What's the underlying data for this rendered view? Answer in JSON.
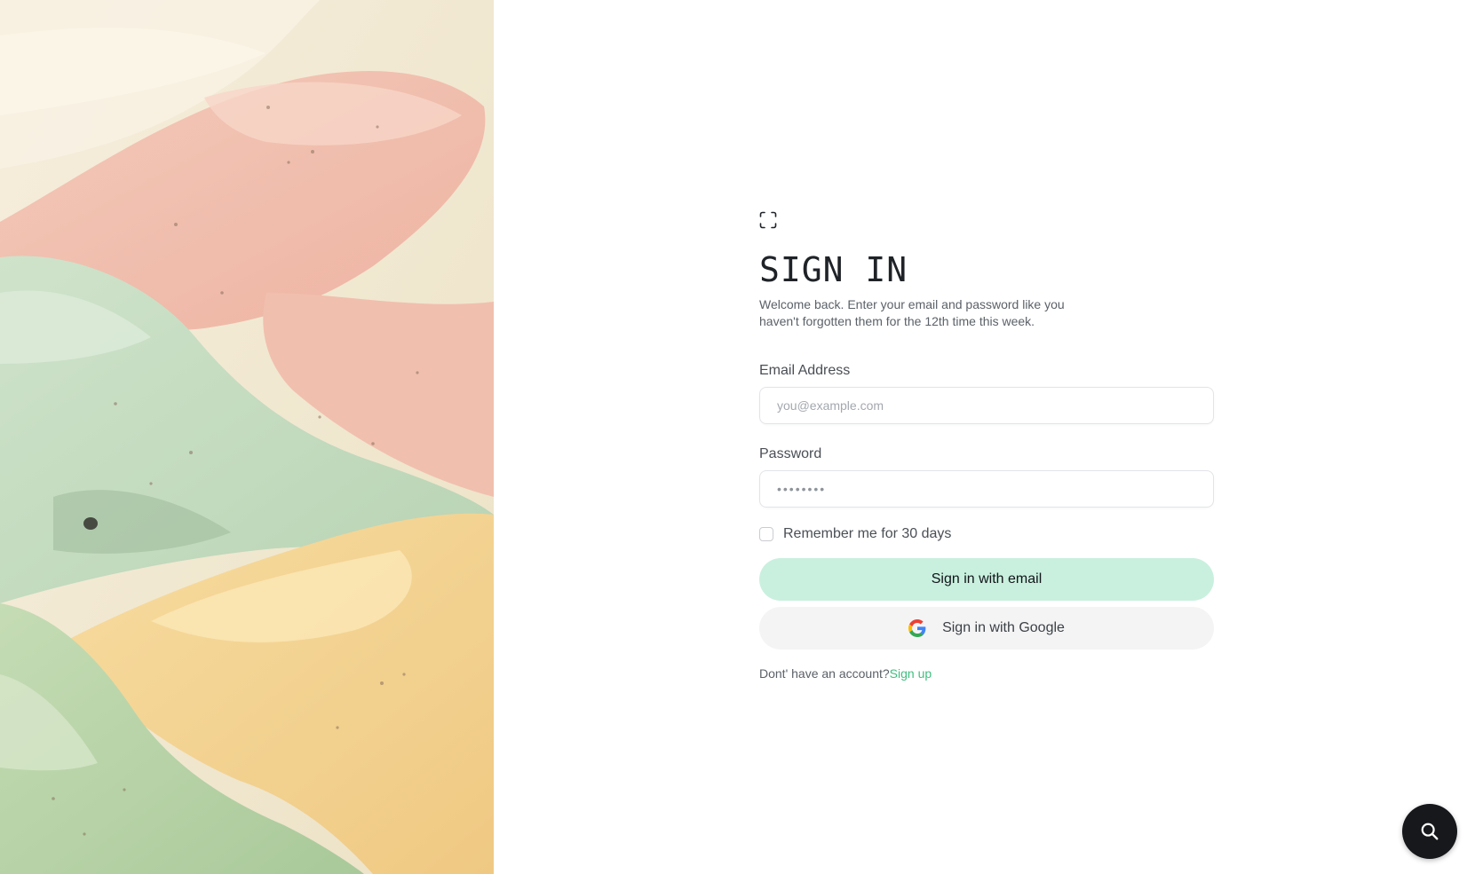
{
  "logo": {
    "icon": "scan-frame-icon"
  },
  "header": {
    "title": "SIGN IN",
    "subtitle": "Welcome back. Enter your email and password like you haven't forgotten them for the 12th time this week."
  },
  "email": {
    "label": "Email Address",
    "placeholder": "you@example.com",
    "value": ""
  },
  "password": {
    "label": "Password",
    "value": "••••••••"
  },
  "remember": {
    "label": "Remember me for 30 days",
    "checked": false
  },
  "buttons": {
    "email_signin": "Sign in with email",
    "google_signin": "Sign in with Google",
    "google_icon": "google-g-icon"
  },
  "signup": {
    "prompt": "Dont' have an account?",
    "link": "Sign up"
  },
  "search_fab": {
    "icon": "search-icon"
  },
  "colors": {
    "primary_button": "#c9f0de",
    "link": "#3fbf7f",
    "secondary_button": "#f4f4f5",
    "fab": "#16181b"
  }
}
